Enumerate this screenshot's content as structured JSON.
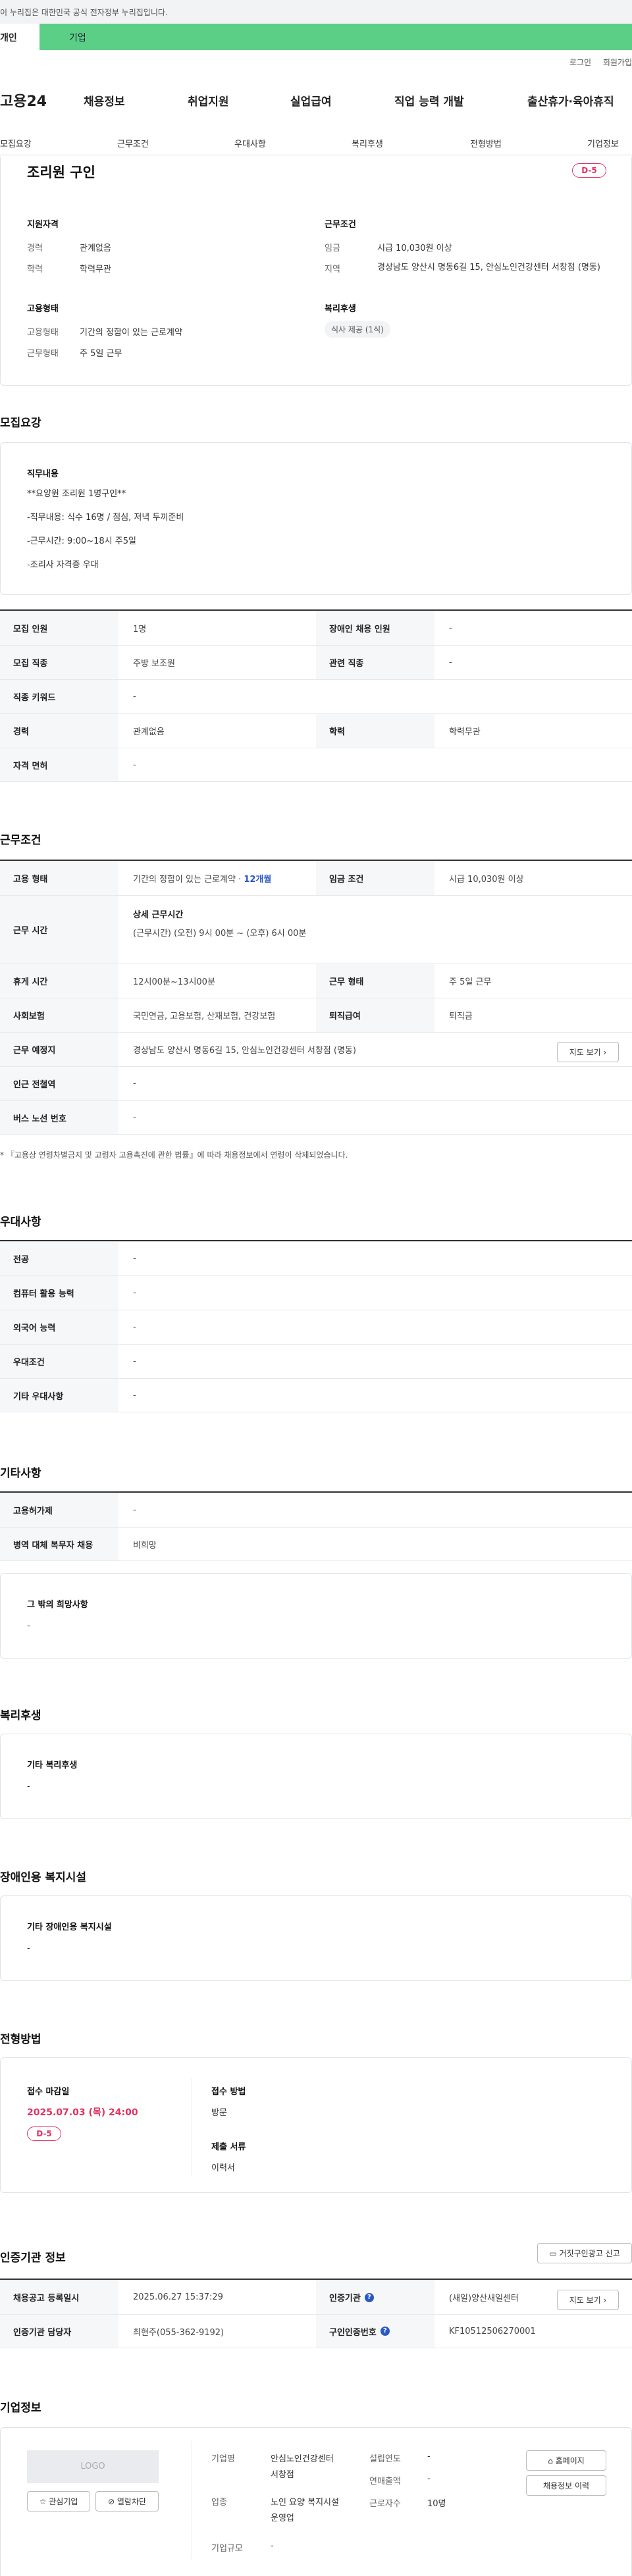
{
  "topbar": {
    "notice": "이 누리집은 대한민국 공식 전자정부 누리집입니다."
  },
  "tabs": {
    "person": "개인",
    "company": "기업"
  },
  "util": {
    "login": "로그인",
    "join": "회원가입"
  },
  "gnb": {
    "logo": "고용24",
    "items": [
      "채용정보",
      "취업지원",
      "실업급여",
      "직업 능력 개발",
      "출산휴가·육아휴직"
    ]
  },
  "anchors": [
    "모집요강",
    "근무조건",
    "우대사항",
    "복리후생",
    "전형방법",
    "기업정보"
  ],
  "summary": {
    "title": "조리원 구인",
    "dday": "D-5",
    "qual_title": "지원자격",
    "career_label": "경력",
    "career_value": "관계없음",
    "edu_label": "학력",
    "edu_value": "학력무관",
    "cond_title": "근무조건",
    "wage_label": "임금",
    "wage_value": "시급 10,030원 이상",
    "region_label": "지역",
    "region_value": "경상남도 양산시 명동6길 15, 안심노인건강센터 서창점 (명동)",
    "emp_title": "고용형태",
    "emp_label": "고용형태",
    "emp_value": "기간의 정함이 있는 근로계약",
    "workform_label": "근무형태",
    "workform_value": "주 5일 근무",
    "welfare_title": "복리후생",
    "welfare_pill": "식사 제공 (1식)"
  },
  "recruit": {
    "title": "모집요강",
    "duty_title": "직무내용",
    "lines": [
      "**요양원 조리원 1명구인**",
      "-직무내용: 식수 16명 / 점심, 저녁 두끼준비",
      "-근무시간: 9:00~18시 주5일",
      "-조리사 자격증 우대"
    ],
    "rows": [
      {
        "k1": "모집 인원",
        "v1": "1명",
        "k2": "장애인 채용 인원",
        "v2": "-"
      },
      {
        "k1": "모집 직종",
        "v1": "주방 보조원",
        "k2": "관련 직종",
        "v2": "-"
      },
      {
        "k1": "직종 키워드",
        "v1": "-"
      },
      {
        "k1": "경력",
        "v1": "관계없음",
        "k2": "학력",
        "v2": "학력무관"
      },
      {
        "k1": "자격 면허",
        "v1": "-"
      }
    ]
  },
  "work": {
    "title": "근무조건",
    "emp_k": "고용 형태",
    "emp_v": "기간의 정함이 있는 근로계약 · ",
    "emp_months": "12개월",
    "wage_k": "임금 조건",
    "wage_v": "시급 10,030원 이상",
    "hours_k": "근무 시간",
    "hours_sub": "상세 근무시간",
    "hours_v": "(근무시간) (오전) 9시 00분 ~ (오후) 6시 00분",
    "rest_k": "휴게 시간",
    "rest_v": "12시00분~13시00분",
    "form_k": "근무 형태",
    "form_v": "주 5일 근무",
    "ins_k": "사회보험",
    "ins_v": "국민연금, 고용보험, 산재보험, 건강보험",
    "sev_k": "퇴직급여",
    "sev_v": "퇴직금",
    "place_k": "근무 예정지",
    "place_v": "경상남도 양산시 명동6길 15, 안심노인건강센터 서창점 (명동)",
    "map_btn": "지도 보기",
    "subway_k": "인근 전철역",
    "subway_v": "-",
    "bus_k": "버스 노선 번호",
    "bus_v": "-",
    "notice": "* 『고용상 연령차별금지 및 고령자 고용촉진에 관한 법률』에 따라 채용정보에서 연령이 삭제되었습니다."
  },
  "pref": {
    "title": "우대사항",
    "rows": [
      [
        "전공",
        "-"
      ],
      [
        "컴퓨터 활용 능력",
        "-"
      ],
      [
        "외국어 능력",
        "-"
      ],
      [
        "우대조건",
        "-"
      ],
      [
        "기타 우대사항",
        "-"
      ]
    ]
  },
  "etc": {
    "title": "기타사항",
    "rows": [
      [
        "고용허가제",
        "-"
      ],
      [
        "병역 대체 복무자 채용",
        "비희망"
      ]
    ],
    "box_title": "그 밖의 희망사항",
    "box_value": "-"
  },
  "welfare": {
    "title": "복리후생",
    "box_title": "기타 복리후생",
    "box_value": "-"
  },
  "disab": {
    "title": "장애인용 복지시설",
    "box_title": "기타 장애인용 복지시설",
    "box_value": "-"
  },
  "process": {
    "title": "전형방법",
    "deadline_label": "접수 마감일",
    "deadline_value": "2025.07.03 (목) 24:00",
    "dday": "D-5",
    "method_label": "접수 방법",
    "method_value": "방문",
    "docs_label": "제출 서류",
    "docs_value": "이력서"
  },
  "cert": {
    "title": "인증기관 정보",
    "report_btn": "거짓구인광고 신고",
    "date_k": "채용공고 등록일시",
    "date_v": "2025.06.27 15:37:29",
    "org_k": "인증기관",
    "org_v": "(새일)양산새일센터",
    "map_btn": "지도 보기",
    "mgr_k": "인증기관 담당자",
    "mgr_v": "최현주(055-362-9192)",
    "no_k": "구인인증번호",
    "no_v": "KF10512506270001"
  },
  "company": {
    "title": "기업정보",
    "logo": "LOGO",
    "fav_btn": "관심기업",
    "block_btn": "열람차단",
    "name_k": "기업명",
    "name_v": "안심노인건강센터 서창점",
    "ind_k": "업종",
    "ind_v": "노인 요양 복지시설 운영업",
    "size_k": "기업규모",
    "size_v": "-",
    "year_k": "설립연도",
    "year_v": "-",
    "sales_k": "연매출액",
    "sales_v": "-",
    "emp_k": "근로자수",
    "emp_v": "10명",
    "home_btn": "홈페이지",
    "hist_btn": "채용정보 이력"
  }
}
